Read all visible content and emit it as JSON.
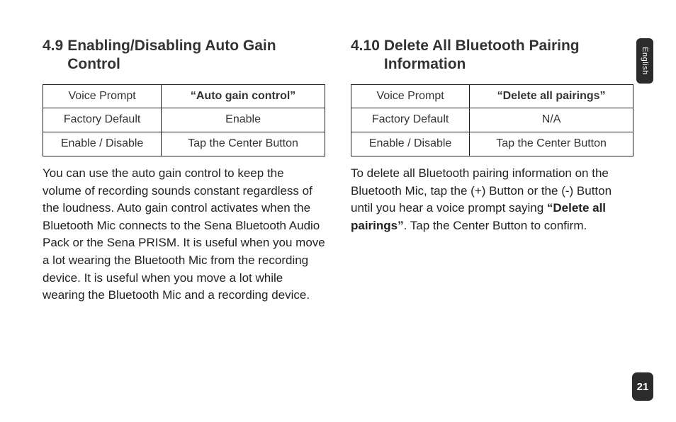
{
  "language_tab": "English",
  "page_number": "21",
  "left": {
    "heading_number": "4.9",
    "heading_text": "Enabling/Disabling Auto Gain Control",
    "rows": [
      {
        "label": "Voice Prompt",
        "value": "“Auto gain control”",
        "value_bold": true
      },
      {
        "label": "Factory Default",
        "value": "Enable",
        "value_bold": false
      },
      {
        "label": "Enable / Disable",
        "value": "Tap the Center Button",
        "value_bold": false
      }
    ],
    "paragraph": "You can use the auto gain control to keep the volume of recording sounds constant regardless of the loudness. Auto gain control activates when the Bluetooth Mic connects to the Sena Bluetooth Audio Pack or the Sena PRISM. It is useful when you move a lot wearing the Bluetooth Mic from the recording device. It is useful when you move a lot while wearing the Bluetooth Mic and a recording device."
  },
  "right": {
    "heading_number": "4.10",
    "heading_text": "Delete All Bluetooth Pairing Information",
    "rows": [
      {
        "label": "Voice Prompt",
        "value": "“Delete all pairings”",
        "value_bold": true
      },
      {
        "label": "Factory Default",
        "value": "N/A",
        "value_bold": false
      },
      {
        "label": "Enable / Disable",
        "value": "Tap the Center Button",
        "value_bold": false
      }
    ],
    "paragraph_pre": "To delete all Bluetooth pairing information on the Bluetooth Mic, tap the (+) Button or the (-) Button until you hear a voice prompt saying ",
    "paragraph_bold": "“Delete all pairings”",
    "paragraph_post": ". Tap the Center Button to confirm."
  }
}
